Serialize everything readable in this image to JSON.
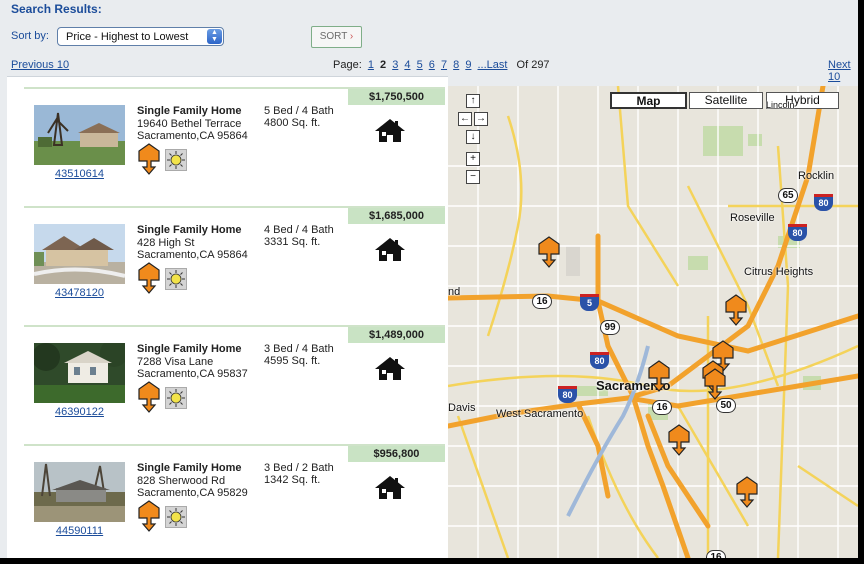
{
  "header": {
    "title": "Search Results:",
    "sort_label": "Sort by:",
    "sort_selected": "Price - Highest to Lowest",
    "sort_button": "SORT"
  },
  "pagination": {
    "previous": "Previous 10",
    "page_label": "Page:",
    "pages": [
      "1",
      "2",
      "3",
      "4",
      "5",
      "6",
      "7",
      "8",
      "9"
    ],
    "current": "2",
    "ellipsis_last": "...Last",
    "of_total": "Of 297",
    "next": "Next 10"
  },
  "listings": [
    {
      "price": "$1,750,500",
      "type": "Single Family Home",
      "address1": "19640 Bethel Terrace",
      "address2": "Sacramento,CA 95864",
      "beds_baths": "5 Bed / 4 Bath",
      "sqft": "4800 Sq. ft.",
      "mls": "43510614"
    },
    {
      "price": "$1,685,000",
      "type": "Single Family Home",
      "address1": "428 High St",
      "address2": "Sacramento,CA 95864",
      "beds_baths": "4 Bed / 4 Bath",
      "sqft": "3331 Sq. ft.",
      "mls": "43478120"
    },
    {
      "price": "$1,489,000",
      "type": "Single Family Home",
      "address1": "7288 Visa Lane",
      "address2": "Sacramento,CA 95837",
      "beds_baths": "3 Bed / 4 Bath",
      "sqft": "4595 Sq. ft.",
      "mls": "46390122"
    },
    {
      "price": "$956,800",
      "type": "Single Family Home",
      "address1": "828 Sherwood Rd",
      "address2": "Sacramento,CA 95829",
      "beds_baths": "3 Bed / 2 Bath",
      "sqft": "1342 Sq. ft.",
      "mls": "44590111"
    }
  ],
  "map": {
    "types": [
      "Map",
      "Satellite",
      "Hybrid"
    ],
    "active_type": "Map",
    "places": [
      "Rocklin",
      "Roseville",
      "Citrus Heights",
      "Sacramento",
      "West Sacramento",
      "Davis",
      "Lincoln",
      "nd"
    ],
    "shields": [
      "65",
      "16",
      "99",
      "16",
      "50",
      "16"
    ],
    "interstates": [
      "80",
      "80",
      "5",
      "80",
      "80"
    ],
    "marker_color": "#f08a1c"
  },
  "icons": {
    "map_pin": "map-pin-icon",
    "sun": "sun-icon",
    "house": "house-icon"
  }
}
